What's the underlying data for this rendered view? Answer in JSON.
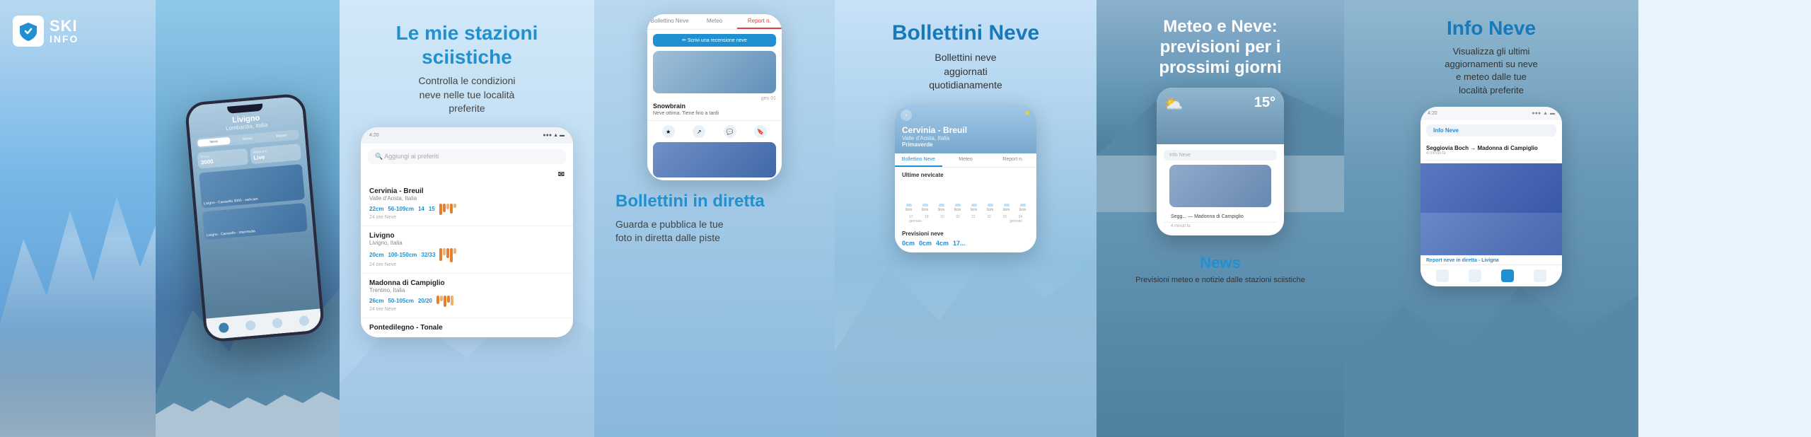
{
  "hero": {
    "logo_text": "SKI",
    "logo_subtext": "INFO"
  },
  "favorites": {
    "title": "Le mie stazioni\nsciistiche",
    "subtitle": "Controlla le condizioni\nneve nelle tue località\npreferite",
    "phone": {
      "time": "4:20",
      "header": "Aggiungi ai preferiti",
      "items": [
        {
          "name": "Cervinia - Breuil",
          "region": "Valle d'Aosta, Italia",
          "stats": "22cm  56-109cm  14  15",
          "stats_label": "24 ore   Neve"
        },
        {
          "name": "Livigno",
          "region": "Livigno, Italia",
          "stats": "20cm  100-150cm  32/33",
          "stats_label": "24 ore   Neve"
        },
        {
          "name": "Madonna di Campiglio",
          "region": "Trentino, Italia",
          "stats": "26cm  50-105cm  20/20",
          "stats_label": "24 ore   Neve"
        },
        {
          "name": "Pontedilegno - Tonale",
          "region": "",
          "stats": "",
          "stats_label": ""
        }
      ]
    }
  },
  "diretta": {
    "title": "Bollettini in diretta",
    "subtitle": "Guarda e pubblica le tue\nfoto in diretta dalle piste",
    "phone": {
      "tabs": [
        "Bollettino Neve",
        "Meteo",
        "Report n."
      ],
      "write_btn": "✏ Scrivi una recensione neve",
      "item1_name": "Snowbrain",
      "item1_desc": "Neve ottima. Tiene fino a tardi",
      "item1_date": "gen 01"
    }
  },
  "bollettini": {
    "title": "Bollettini Neve",
    "subtitle": "Bollettini neve\naggiornati\nquotidianamente",
    "phone": {
      "location": "Cervinia - Breuil",
      "region": "Valle d'Aosta, Italia",
      "season": "Primaverde",
      "tabs": [
        "Bollettino Neve",
        "Meteo",
        "Report n."
      ],
      "section_ultime": "Ultime nevicate",
      "chart_labels": [
        "0cm",
        "0cm",
        "0cm",
        "0cm",
        "0cm",
        "0cm",
        "0cm",
        "0cm"
      ],
      "dates": [
        "17",
        "18",
        "19",
        "20",
        "21",
        "22",
        "23",
        "24"
      ],
      "month": "gennaio",
      "section_previsioni": "Previsioni neve",
      "forecast": [
        "0cm",
        "0cm",
        "4cm",
        "17..."
      ]
    }
  },
  "meteo": {
    "title": "Meteo e Neve:\nprevisioni per i\nprossimi giorni",
    "phone": {
      "weather_icon": "⛅",
      "temperature": "15°",
      "search_placeholder": "Info Neve"
    },
    "news_title": "News",
    "news_subtitle": "Previsioni meteo e  notizie\ndalle stazioni sciistiche"
  },
  "info_neve": {
    "title": "Info Neve",
    "subtitle": "Visualizza gli ultimi\naggiornamenti su neve\ne meteo dalle tue\nlocalità preferite",
    "phone": {
      "time": "4:20",
      "search_label": "Info Neve",
      "item1_title": "Seggiovia Boch → Madonna di Campiglio",
      "item1_meta": "4 minuti fa",
      "footer_item": "Report neve in diretta - Livigna"
    }
  }
}
